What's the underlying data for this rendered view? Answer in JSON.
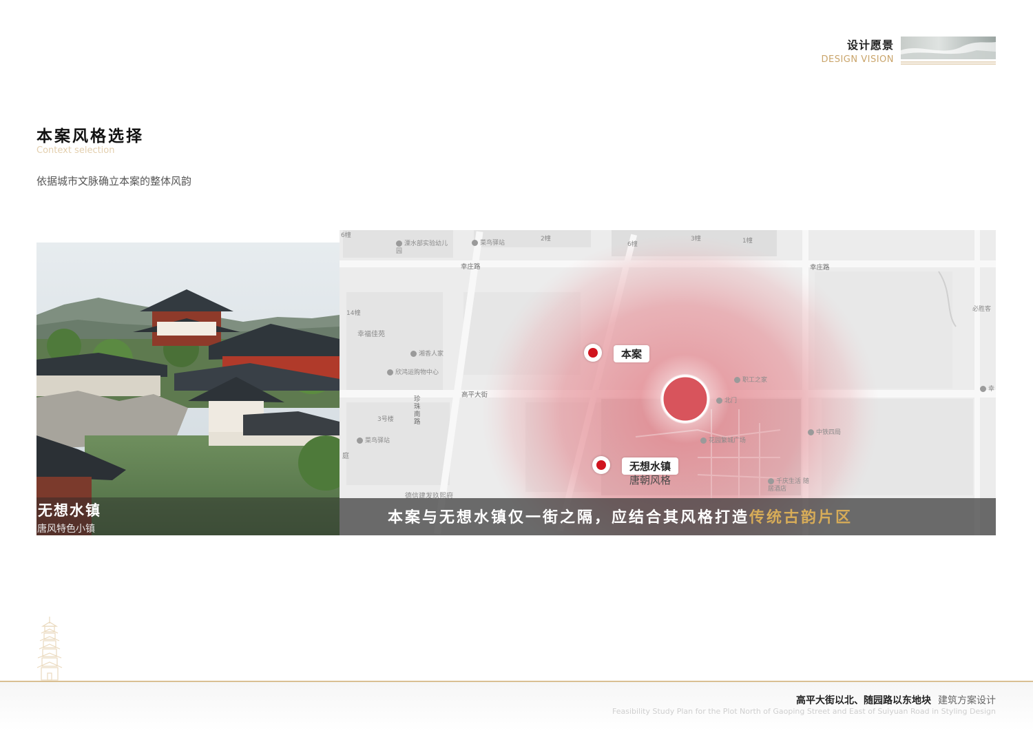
{
  "header": {
    "section_cn": "设计愿景",
    "section_en": "DESIGN VISION"
  },
  "section": {
    "title": "本案风格选择",
    "subtitle_en": "Context selection",
    "description": "依据城市文脉确立本案的整体风韵"
  },
  "photo": {
    "caption_title": "无想水镇",
    "caption_sub": "唐风特色小镇"
  },
  "map": {
    "roads": {
      "xingzhuang_left": "幸庄路",
      "xingzhuang_right": "幸庄路",
      "gaoping": "高平大街",
      "zhenzhu": "珍珠南路"
    },
    "labels": {
      "b6": "6幢",
      "b2": "2幢",
      "b6b": "6幢",
      "b3": "3幢",
      "b1": "1幢",
      "b14": "14幢",
      "xingfu": "幸福佳苑",
      "b3h": "3号楼",
      "ting": "庭",
      "dexin": "德信建发玖熙府",
      "dexin2": "信建发玖熙府",
      "bishengke": "必胜客",
      "xingfu2": "幸福佳苑"
    },
    "pois": {
      "kindergarten": "溧水部实验幼儿园",
      "caoniao1": "菜鸟驿站",
      "xiangxiang": "湘香人家",
      "xinhong": "欣鸿运购物中心",
      "caoniao2": "菜鸟驿站",
      "zhigong": "职工之家",
      "beimen": "北门",
      "zhongtie": "中铁四局",
      "huayuan": "花园",
      "huayuan_sq": "花园繁城广场",
      "qiankuan": "千庆生活",
      "jiudian": "随居酒店",
      "xing": "幸"
    },
    "markers": {
      "project": "本案",
      "wuxiang": "无想水镇",
      "tang_style": "唐朝风格"
    },
    "banner": {
      "main": "本案与无想水镇仅一街之隔，应结合其风格打造",
      "highlight": "传统古韵片区"
    }
  },
  "footer": {
    "plot_cn": "高平大街以北、随园路以东地块",
    "design_cn": "建筑方案设计",
    "plot_en": "Feasibility Study Plan for the Plot North of Gaoping Street and East of Suiyuan Road in Styling Design"
  }
}
